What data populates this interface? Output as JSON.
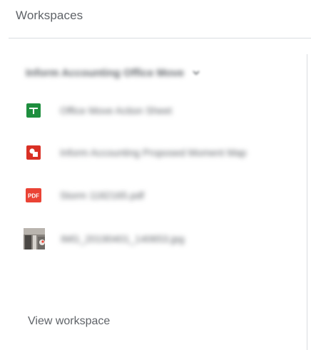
{
  "header": {
    "title": "Workspaces"
  },
  "workspace": {
    "name": "Inform Accounting Office Move",
    "files": [
      {
        "icon": "google-sheets-icon",
        "name": "Office Move Action Sheet"
      },
      {
        "icon": "google-slides-icon",
        "name": "Inform Accounting Proposed Moment Map"
      },
      {
        "icon": "pdf-icon",
        "icon_text": "PDF",
        "name": "Storm 1182165.pdf"
      },
      {
        "icon": "image-thumbnail",
        "name": "IMG_20190401_140653.jpg"
      }
    ],
    "view_label": "View workspace"
  },
  "colors": {
    "sheets_green": "#1e8e3e",
    "slides_red": "#d93025",
    "pdf_red": "#ea4335",
    "text_gray": "#5f6368",
    "divider": "#dadce0"
  }
}
